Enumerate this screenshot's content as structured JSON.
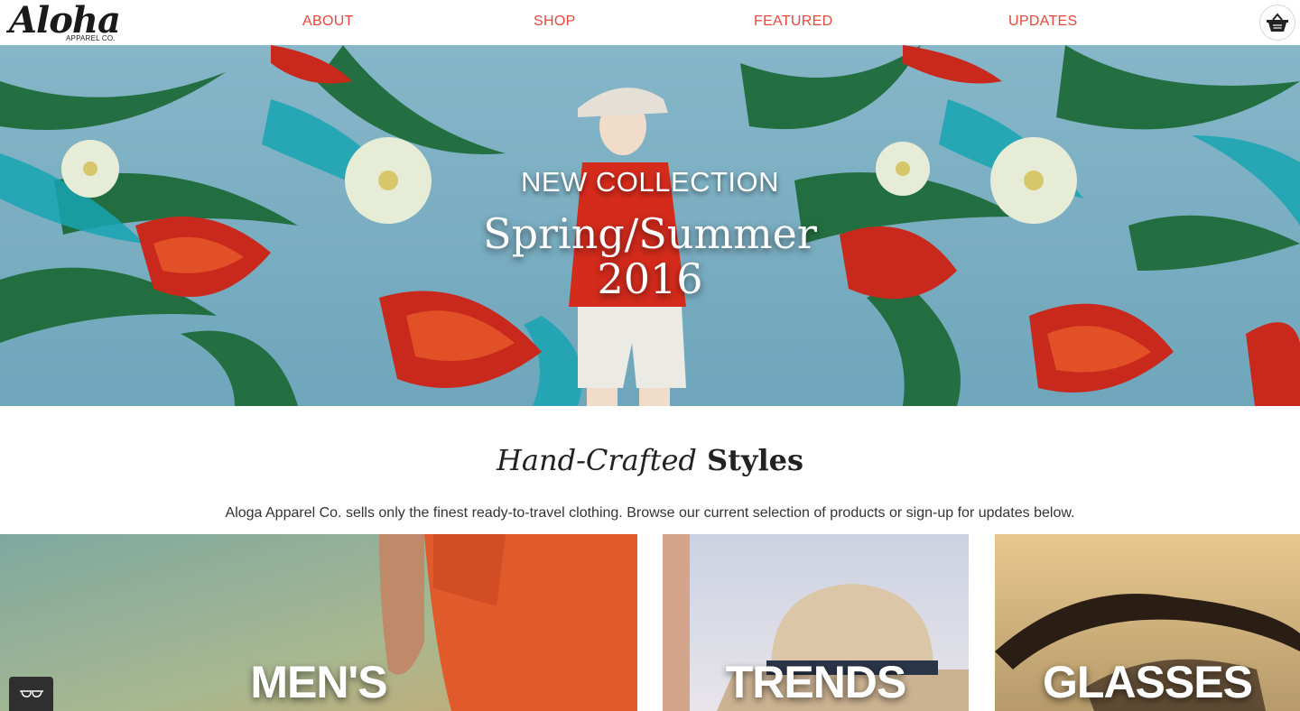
{
  "header": {
    "logo": {
      "script": "Aloha",
      "sub": "APPAREL CO."
    },
    "nav": [
      {
        "label": "ABOUT"
      },
      {
        "label": "SHOP"
      },
      {
        "label": "FEATURED"
      },
      {
        "label": "UPDATES"
      }
    ],
    "cart_icon": "basket-icon"
  },
  "hero": {
    "kicker": "NEW COLLECTION",
    "title": "Spring/Summer",
    "year": "2016"
  },
  "intro": {
    "title_italic": "Hand-Crafted",
    "title_bold": "Styles",
    "text": "Aloga Apparel Co. sells only the finest ready-to-travel clothing. Browse our current selection of products or sign-up for updates below."
  },
  "categories": [
    {
      "label": "MEN'S"
    },
    {
      "label": "TRENDS"
    },
    {
      "label": "GLASSES"
    }
  ],
  "widget": {
    "icon": "glasses-icon"
  },
  "colors": {
    "accent": "#e8483b",
    "hero_bg": "#7fb3c7",
    "text": "#222222"
  }
}
